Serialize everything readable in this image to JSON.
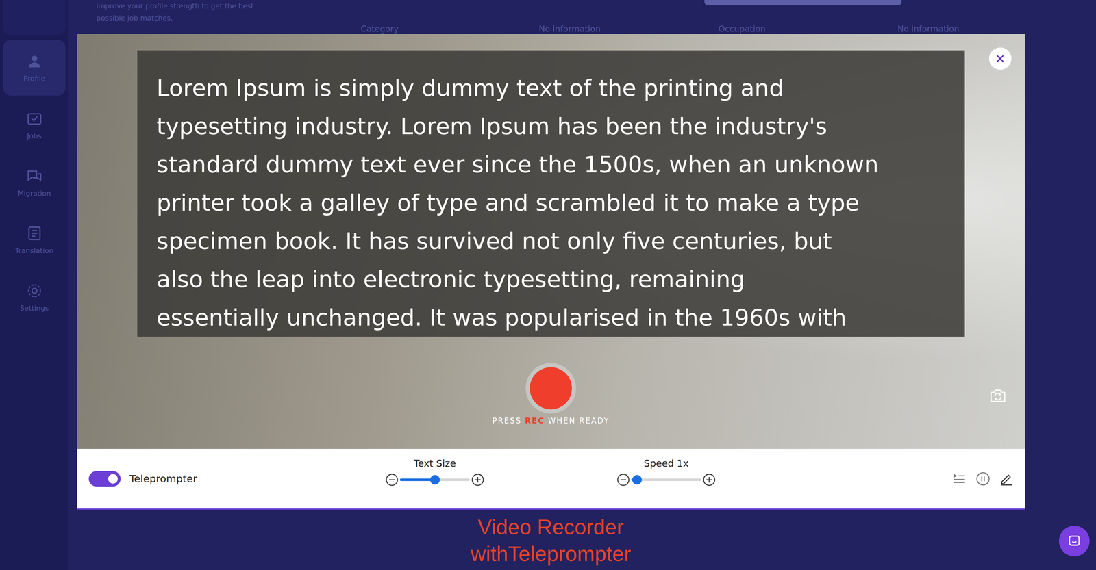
{
  "background": {
    "tip_lines": [
      "improve your profile strength to get the best",
      "possible job matches."
    ],
    "sidebar": [
      {
        "label": "Profile",
        "icon": "person",
        "selected": true
      },
      {
        "label": "Jobs",
        "icon": "jobs",
        "selected": false
      },
      {
        "label": "Migration",
        "icon": "chat",
        "selected": false
      },
      {
        "label": "Translation",
        "icon": "doc",
        "selected": false
      },
      {
        "label": "Settings",
        "icon": "gear",
        "selected": false
      }
    ],
    "fields": [
      "Category",
      "No information",
      "Occupation",
      "No information"
    ]
  },
  "modal": {
    "teleprompter_lines": [
      "Lorem Ipsum is simply dummy text of the printing and",
      "typesetting industry. Lorem Ipsum has been the industry's",
      "standard dummy text ever since the 1500s, when an unknown",
      "printer took a galley of type and scrambled it to make a type",
      "specimen book. It has survived not only five centuries, but",
      "also the leap into electronic typesetting, remaining",
      "essentially unchanged. It was popularised in the 1960s with"
    ],
    "record_prompt": {
      "before": "PRESS ",
      "highlight": "REC",
      "after": " WHEN READY"
    },
    "toggle": {
      "label": "Teleprompter",
      "on": true
    },
    "sliders": [
      {
        "label": "Text Size",
        "level": 0.5
      },
      {
        "label": "Speed 1x",
        "level": 0.08
      }
    ]
  },
  "caption": [
    "Video Recorder",
    "withTeleprompter"
  ]
}
